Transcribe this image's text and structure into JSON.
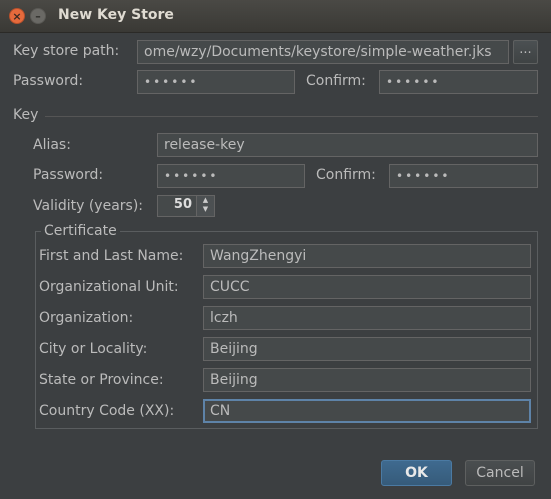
{
  "window": {
    "title": "New Key Store",
    "close_glyph": "×",
    "minimize_glyph": "–"
  },
  "keystore": {
    "path_label": "Key store path:",
    "path_value": "ome/wzy/Documents/keystore/simple-weather.jks",
    "browse_label": "...",
    "password_label": "Password:",
    "password_value": "••••••",
    "confirm_label": "Confirm:",
    "confirm_value": "••••••"
  },
  "key": {
    "section_label": "Key",
    "alias_label": "Alias:",
    "alias_value": "release-key",
    "password_label": "Password:",
    "password_value": "••••••",
    "confirm_label": "Confirm:",
    "confirm_value": "••••••",
    "validity_label": "Validity (years):",
    "validity_value": "50",
    "spinner_up": "▲",
    "spinner_down": "▼"
  },
  "certificate": {
    "section_label": "Certificate",
    "fields": [
      {
        "label": "First and Last Name:",
        "value": "WangZhengyi"
      },
      {
        "label": "Organizational Unit:",
        "value": "CUCC"
      },
      {
        "label": "Organization:",
        "value": "lczh"
      },
      {
        "label": "City or Locality:",
        "value": "Beijing"
      },
      {
        "label": "State or Province:",
        "value": "Beijing"
      },
      {
        "label": "Country Code (XX):",
        "value": "CN"
      }
    ]
  },
  "buttons": {
    "ok_label": "OK",
    "cancel_label": "Cancel"
  },
  "colors": {
    "background": "#3c3f41",
    "field_bg": "#45494a",
    "focus_border": "#5e83a8",
    "ok_button": "#3f6a8f",
    "close_button": "#e66a3c"
  }
}
